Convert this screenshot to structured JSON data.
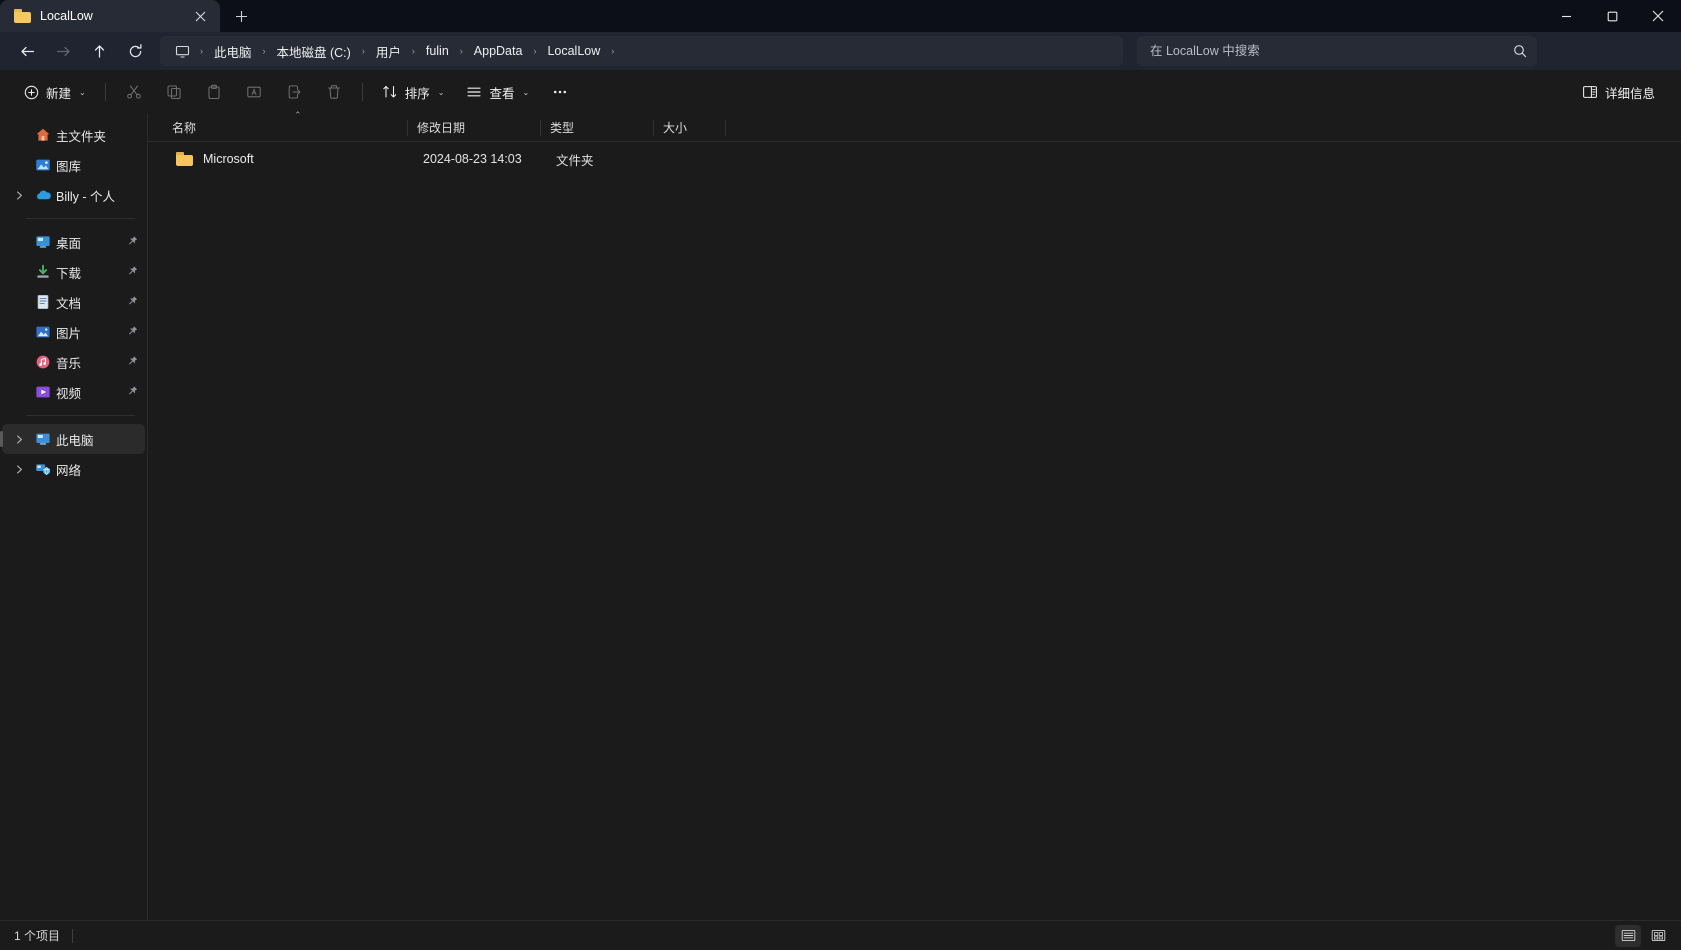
{
  "window": {
    "tab_title": "LocalLow",
    "tab_icon": "folder-icon",
    "close_tab_icon": "close-icon",
    "new_tab_icon": "plus-icon",
    "minimize_icon": "minimize-icon",
    "maximize_icon": "maximize-icon",
    "close_icon": "close-icon"
  },
  "addressbar": {
    "back_icon": "arrow-left-icon",
    "forward_icon": "arrow-right-icon",
    "up_icon": "arrow-up-icon",
    "refresh_icon": "refresh-icon",
    "pc_icon": "this-pc-icon",
    "breadcrumbs": [
      "此电脑",
      "本地磁盘 (C:)",
      "用户",
      "fulin",
      "AppData",
      "LocalLow"
    ],
    "separator": "›",
    "search_placeholder": "在 LocalLow 中搜索",
    "search_value": "",
    "search_icon": "search-icon"
  },
  "toolbar": {
    "new_label": "新建",
    "new_icon": "plus-circle-icon",
    "cut_icon": "scissors-icon",
    "copy_icon": "copy-icon",
    "paste_icon": "paste-icon",
    "rename_icon": "rename-icon",
    "share_icon": "share-icon",
    "delete_icon": "trash-icon",
    "sort_label": "排序",
    "sort_icon": "sort-icon",
    "view_label": "查看",
    "view_icon": "view-list-icon",
    "more_label": "···",
    "more_icon": "ellipsis-icon",
    "details_label": "详细信息",
    "details_icon": "details-pane-icon",
    "caret": "⌄"
  },
  "sidebar": {
    "groups": [
      {
        "items": [
          {
            "label": "主文件夹",
            "icon": "home-icon",
            "expandable": false,
            "pinned": false,
            "selected": false
          },
          {
            "label": "图库",
            "icon": "gallery-icon",
            "expandable": false,
            "pinned": false,
            "selected": false
          },
          {
            "label": "Billy - 个人",
            "icon": "onedrive-cloud-icon",
            "expandable": true,
            "pinned": false,
            "selected": false
          }
        ]
      },
      {
        "items": [
          {
            "label": "桌面",
            "icon": "desktop-icon",
            "expandable": false,
            "pinned": true,
            "selected": false
          },
          {
            "label": "下载",
            "icon": "downloads-icon",
            "expandable": false,
            "pinned": true,
            "selected": false
          },
          {
            "label": "文档",
            "icon": "documents-icon",
            "expandable": false,
            "pinned": true,
            "selected": false
          },
          {
            "label": "图片",
            "icon": "pictures-icon",
            "expandable": false,
            "pinned": true,
            "selected": false
          },
          {
            "label": "音乐",
            "icon": "music-icon",
            "expandable": false,
            "pinned": true,
            "selected": false
          },
          {
            "label": "视频",
            "icon": "videos-icon",
            "expandable": false,
            "pinned": true,
            "selected": false
          }
        ]
      },
      {
        "items": [
          {
            "label": "此电脑",
            "icon": "this-pc-icon",
            "expandable": true,
            "pinned": false,
            "selected": true
          },
          {
            "label": "网络",
            "icon": "network-icon",
            "expandable": true,
            "pinned": false,
            "selected": false
          }
        ]
      }
    ],
    "pin_icon": "pin-icon",
    "expand_icon": "chevron-right-icon"
  },
  "filelist": {
    "columns": [
      {
        "key": "name",
        "label": "名称",
        "sorted": "asc"
      },
      {
        "key": "date",
        "label": "修改日期",
        "sorted": ""
      },
      {
        "key": "type",
        "label": "类型",
        "sorted": ""
      },
      {
        "key": "size",
        "label": "大小",
        "sorted": ""
      }
    ],
    "sort_marker": "⌃",
    "rows": [
      {
        "name": "Microsoft",
        "date": "2024-08-23 14:03",
        "type": "文件夹",
        "size": "",
        "icon": "folder-icon"
      }
    ]
  },
  "statusbar": {
    "item_count": "1 个项目",
    "details_view_icon": "details-view-icon",
    "large_icons_view_icon": "large-icons-view-icon",
    "active_view": "details"
  }
}
